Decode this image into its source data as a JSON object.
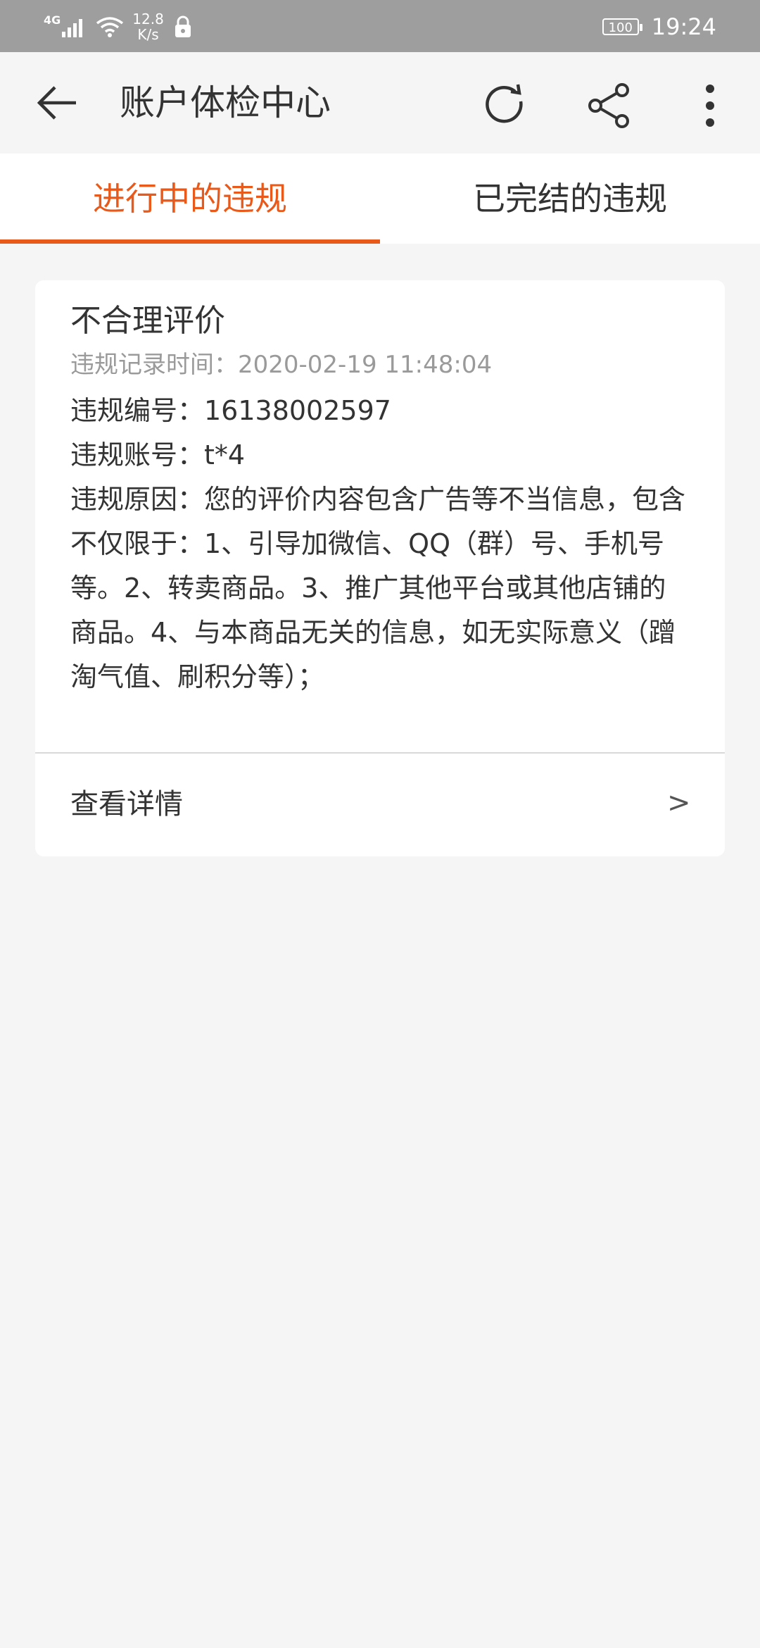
{
  "status_bar": {
    "network": "4G",
    "speed": "12.8\nK/s",
    "speed_value": "12.8",
    "speed_unit": "K/s",
    "battery": "100",
    "time": "19:24"
  },
  "header": {
    "title": "账户体检中心",
    "icons": [
      "back-arrow-icon",
      "refresh-icon",
      "share-icon",
      "more-vertical-icon"
    ]
  },
  "tabs": [
    {
      "label": "进行中的违规",
      "active": true
    },
    {
      "label": "已完结的违规",
      "active": false
    }
  ],
  "violation": {
    "title": "不合理评价",
    "time_label": "违规记录时间：2020-02-19 11:48:04",
    "number_line": "违规编号：16138002597",
    "account_line": "违规账号：t*4",
    "reason": "违规原因：您的评价内容包含广告等不当信息，包含不仅限于：1、引导加微信、QQ（群）号、手机号等。2、转卖商品。3、推广其他平台或其他店铺的商品。4、与本商品无关的信息，如无实际意义（蹭淘气值、刷积分等）；",
    "detail_label": "查看详情",
    "detail_arrow": ">"
  },
  "colors": {
    "accent": "#e8591a",
    "status_bar_bg": "#9e9e9e",
    "page_bg": "#f5f5f5"
  }
}
